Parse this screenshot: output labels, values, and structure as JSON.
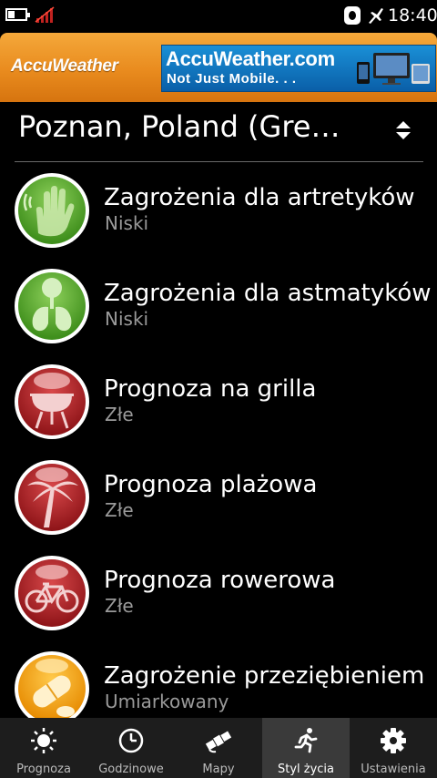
{
  "status": {
    "time": "18:40"
  },
  "banner": {
    "logo": "AccuWeather",
    "ad_title": "AccuWeather.com",
    "ad_subtitle": "Not Just Mobile. . ."
  },
  "location": {
    "name": "Poznan, Poland (Gre…"
  },
  "items": [
    {
      "title": "Zagrożenia dla artretyków",
      "value": "Niski",
      "icon": "hand-icon",
      "color": "#5fae2e"
    },
    {
      "title": "Zagrożenia dla astmatyków",
      "value": "Niski",
      "icon": "lungs-icon",
      "color": "#5fae2e"
    },
    {
      "title": "Prognoza na grilla",
      "value": "Złe",
      "icon": "grill-icon",
      "color": "#b81f24"
    },
    {
      "title": "Prognoza plażowa",
      "value": "Złe",
      "icon": "palm-tree-icon",
      "color": "#b81f24"
    },
    {
      "title": "Prognoza rowerowa",
      "value": "Złe",
      "icon": "bicycle-icon",
      "color": "#b81f24"
    },
    {
      "title": "Zagrożenie przeziębieniem",
      "value": "Umiarkowany",
      "icon": "pill-icon",
      "color": "#f5a300"
    }
  ],
  "nav": [
    {
      "label": "Prognoza",
      "icon": "sun-icon"
    },
    {
      "label": "Godzinowe",
      "icon": "clock-icon"
    },
    {
      "label": "Mapy",
      "icon": "satellite-icon"
    },
    {
      "label": "Styl życia",
      "icon": "runner-icon",
      "active": true
    },
    {
      "label": "Ustawienia",
      "icon": "gear-icon"
    }
  ]
}
